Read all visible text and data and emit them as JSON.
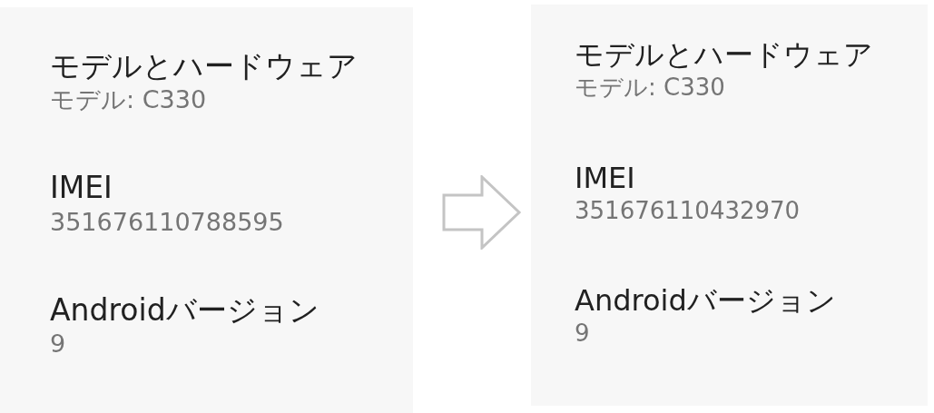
{
  "panels": [
    {
      "items": [
        {
          "title": "モデルとハードウェア",
          "value": "モデル: C330"
        },
        {
          "title": "IMEI",
          "value": "351676110788595"
        },
        {
          "title": "Androidバージョン",
          "value": "9"
        }
      ]
    },
    {
      "items": [
        {
          "title": "モデルとハードウェア",
          "value": "モデル: C330"
        },
        {
          "title": "IMEI",
          "value": "351676110432970"
        },
        {
          "title": "Androidバージョン",
          "value": "9"
        }
      ]
    }
  ]
}
